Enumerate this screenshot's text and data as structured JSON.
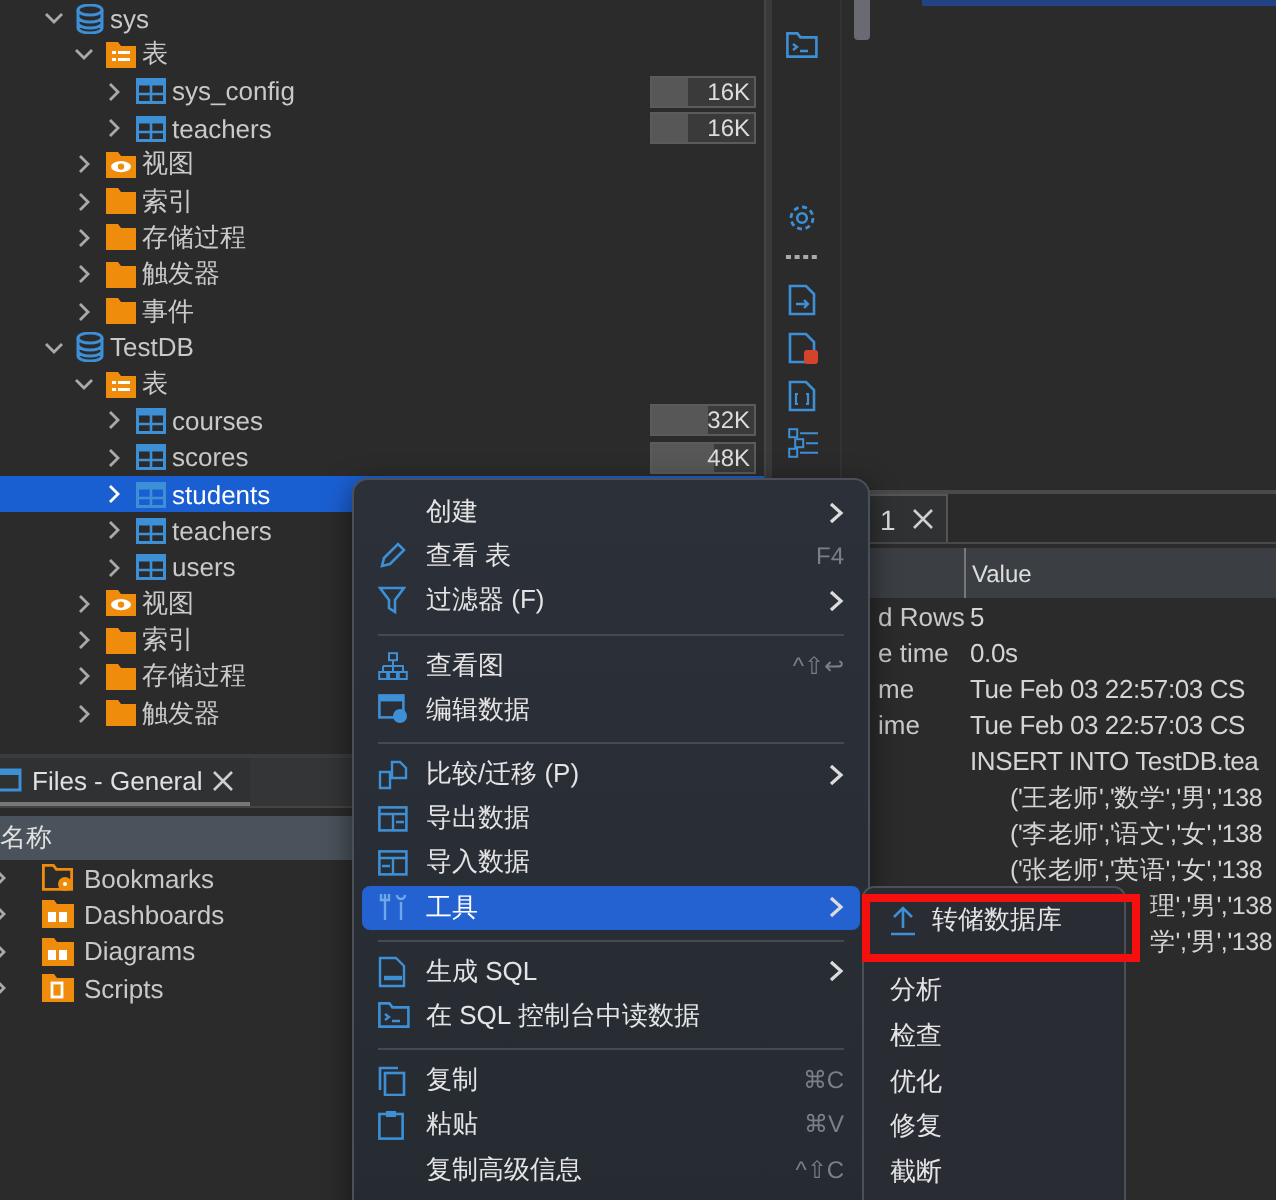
{
  "tree": [
    {
      "label": "sys",
      "kind": "database",
      "expanded": true,
      "selected": false,
      "children": [
        {
          "label": "表",
          "kind": "tables",
          "expanded": true,
          "selected": false,
          "children": [
            {
              "label": "sys_config",
              "kind": "table",
              "expanded": false,
              "selected": false,
              "size": "16K",
              "level": 0.35
            },
            {
              "label": "teachers",
              "kind": "table",
              "expanded": false,
              "selected": false,
              "size": "16K",
              "level": 0.35
            }
          ]
        },
        {
          "label": "视图",
          "kind": "views",
          "expanded": false,
          "selected": false
        },
        {
          "label": "索引",
          "kind": "folder",
          "expanded": false,
          "selected": false
        },
        {
          "label": "存储过程",
          "kind": "folder",
          "expanded": false,
          "selected": false
        },
        {
          "label": "触发器",
          "kind": "folder",
          "expanded": false,
          "selected": false
        },
        {
          "label": "事件",
          "kind": "folder",
          "expanded": false,
          "selected": false
        }
      ]
    },
    {
      "label": "TestDB",
      "kind": "database",
      "expanded": true,
      "selected": false,
      "children": [
        {
          "label": "表",
          "kind": "tables",
          "expanded": true,
          "selected": false,
          "children": [
            {
              "label": "courses",
              "kind": "table",
              "expanded": false,
              "selected": false,
              "size": "32K",
              "level": 0.55
            },
            {
              "label": "scores",
              "kind": "table",
              "expanded": false,
              "selected": false,
              "size": "48K",
              "level": 0.6
            },
            {
              "label": "students",
              "kind": "table",
              "expanded": false,
              "selected": true
            },
            {
              "label": "teachers",
              "kind": "table",
              "expanded": false,
              "selected": false
            },
            {
              "label": "users",
              "kind": "table",
              "expanded": false,
              "selected": false
            }
          ]
        },
        {
          "label": "视图",
          "kind": "views",
          "expanded": false,
          "selected": false
        },
        {
          "label": "索引",
          "kind": "folder",
          "expanded": false,
          "selected": false
        },
        {
          "label": "存储过程",
          "kind": "folder",
          "expanded": false,
          "selected": false
        },
        {
          "label": "触发器",
          "kind": "folder",
          "expanded": false,
          "selected": false
        }
      ]
    }
  ],
  "files_panel": {
    "tab": "Files - General",
    "header": "名称",
    "items": [
      {
        "label": "Bookmarks",
        "kind": "bookmarks"
      },
      {
        "label": "Dashboards",
        "kind": "dashboards"
      },
      {
        "label": "Diagrams",
        "kind": "diagrams"
      },
      {
        "label": "Scripts",
        "kind": "scripts"
      }
    ]
  },
  "results": {
    "tab": "1",
    "column": "Value",
    "rows": [
      {
        "kind": "field",
        "name": "d Rows",
        "value": "5"
      },
      {
        "kind": "field",
        "name": "e time",
        "value": "0.0s"
      },
      {
        "kind": "field",
        "name": "me",
        "value": "Tue Feb 03 22:57:03 CS"
      },
      {
        "kind": "field",
        "name": "ime",
        "value": "Tue Feb 03 22:57:03 CS"
      },
      {
        "kind": "statement",
        "value": "INSERT INTO TestDB.tea"
      },
      {
        "kind": "values",
        "value": "('王老师','数学','男','138"
      },
      {
        "kind": "values",
        "value": "('李老师','语文','女','138"
      },
      {
        "kind": "values",
        "value": "('张老师','英语','女','138"
      },
      {
        "kind": "fragment",
        "value": "理','男','138"
      },
      {
        "kind": "fragment",
        "value": "学','男','138"
      }
    ]
  },
  "context_menu": {
    "sections": [
      [
        {
          "label": "创建",
          "submenu": true,
          "selected": false
        },
        {
          "label": "查看 表",
          "shortcut": "F4",
          "submenu": false,
          "selected": false
        },
        {
          "label": "过滤器 (F)",
          "submenu": true,
          "selected": false
        }
      ],
      [
        {
          "label": "查看图",
          "shortcut": "^⇧↩",
          "submenu": false,
          "selected": false
        },
        {
          "label": "编辑数据",
          "submenu": false,
          "selected": false
        }
      ],
      [
        {
          "label": "比较/迁移 (P)",
          "submenu": true,
          "selected": false
        },
        {
          "label": "导出数据",
          "submenu": false,
          "selected": false
        },
        {
          "label": "导入数据",
          "submenu": false,
          "selected": false
        },
        {
          "label": "工具",
          "submenu": true,
          "selected": true
        }
      ],
      [
        {
          "label": "生成 SQL",
          "submenu": true,
          "selected": false
        },
        {
          "label": "在 SQL 控制台中读数据",
          "submenu": false,
          "selected": false
        }
      ],
      [
        {
          "label": "复制",
          "shortcut": "⌘C",
          "submenu": false,
          "selected": false
        },
        {
          "label": "粘贴",
          "shortcut": "⌘V",
          "submenu": false,
          "selected": false
        },
        {
          "label": "复制高级信息",
          "shortcut": "^⇧C",
          "submenu": false,
          "selected": false
        }
      ]
    ]
  },
  "submenu": {
    "items": [
      {
        "label": "转储数据库",
        "highlighted": true
      },
      {
        "label": "分析",
        "highlighted": false
      },
      {
        "label": "检查",
        "highlighted": false
      },
      {
        "label": "优化",
        "highlighted": false
      },
      {
        "label": "修复",
        "highlighted": false
      },
      {
        "label": "截断",
        "highlighted": false
      }
    ]
  }
}
